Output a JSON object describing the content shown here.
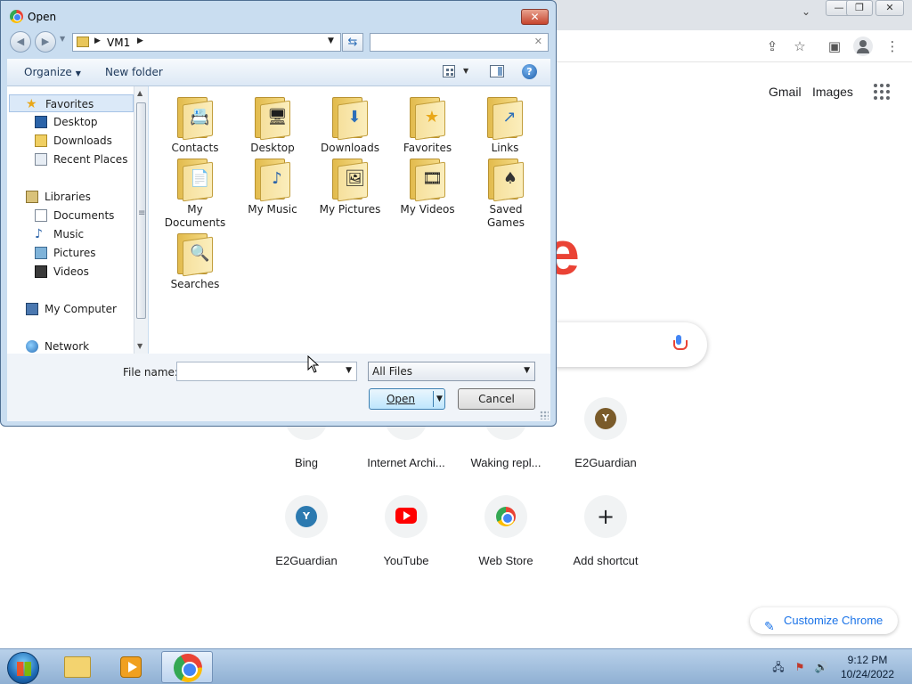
{
  "chrome": {
    "window_controls": [
      "—",
      "❐",
      "✕"
    ],
    "tabs_chevron": "⌄",
    "share_icon": "share-icon",
    "bookmark_icon": "☆",
    "sidepanel_icon": "side-panel-icon",
    "menu_icon": "⋮",
    "header_links": [
      "Gmail",
      "Images"
    ],
    "logo_fragment": "e",
    "shortcuts_row1": [
      {
        "label": "Bing",
        "icon": "bing-icon"
      },
      {
        "label": "Internet Archi...",
        "icon": "archive-icon"
      },
      {
        "label": "Waking repl...",
        "icon": "waking-icon"
      },
      {
        "label": "E2Guardian",
        "icon": "e2guardian-icon",
        "letter": "Y",
        "color": "#7a5b2a"
      }
    ],
    "shortcuts_row2": [
      {
        "label": "E2Guardian",
        "icon": "e2guardian-icon",
        "letter": "Y",
        "color": "#2c7ab0"
      },
      {
        "label": "YouTube",
        "icon": "youtube-icon"
      },
      {
        "label": "Web Store",
        "icon": "web-store-icon"
      },
      {
        "label": "Add shortcut",
        "icon": "plus-icon",
        "symbol": "+"
      }
    ],
    "customize_label": "Customize Chrome"
  },
  "dialog": {
    "title": "Open",
    "close_symbol": "✕",
    "back_symbol": "◀",
    "forward_symbol": "▶",
    "address": {
      "segment": "VM1",
      "separator": "▶"
    },
    "search_clear": "✕",
    "refresh_symbol": "⇆",
    "toolbar": {
      "organize": "Organize",
      "new_folder": "New folder",
      "help": "?"
    },
    "nav": {
      "favorites": "Favorites",
      "desktop": "Desktop",
      "downloads": "Downloads",
      "recent": "Recent Places",
      "libraries": "Libraries",
      "documents": "Documents",
      "music": "Music",
      "pictures": "Pictures",
      "videos": "Videos",
      "computer": "My Computer",
      "network": "Network"
    },
    "files": [
      {
        "name": "Contacts",
        "badge": "📇"
      },
      {
        "name": "Desktop",
        "badge": "🖥"
      },
      {
        "name": "Downloads",
        "badge": "⬇"
      },
      {
        "name": "Favorites",
        "badge": "★"
      },
      {
        "name": "Links",
        "badge": "↗"
      },
      {
        "name": "My Documents",
        "badge": "📄"
      },
      {
        "name": "My Music",
        "badge": "♪"
      },
      {
        "name": "My Pictures",
        "badge": "🖼"
      },
      {
        "name": "My Videos",
        "badge": "🎞"
      },
      {
        "name": "Saved Games",
        "badge": "♠"
      },
      {
        "name": "Searches",
        "badge": "🔍"
      }
    ],
    "filename_label": "File name:",
    "filename_value": "",
    "filetype_value": "All Files",
    "open_label": "Open",
    "cancel_label": "Cancel"
  },
  "taskbar": {
    "time": "9:12 PM",
    "date": "10/24/2022",
    "tray_icons": [
      "network-icon",
      "flag-icon",
      "volume-icon"
    ]
  },
  "colors": {
    "chrome_accent": "#1a73e8",
    "logo_red": "#ea4335",
    "dialog_frame": "#c9ddf0",
    "taskbar": "#a7c2df"
  }
}
